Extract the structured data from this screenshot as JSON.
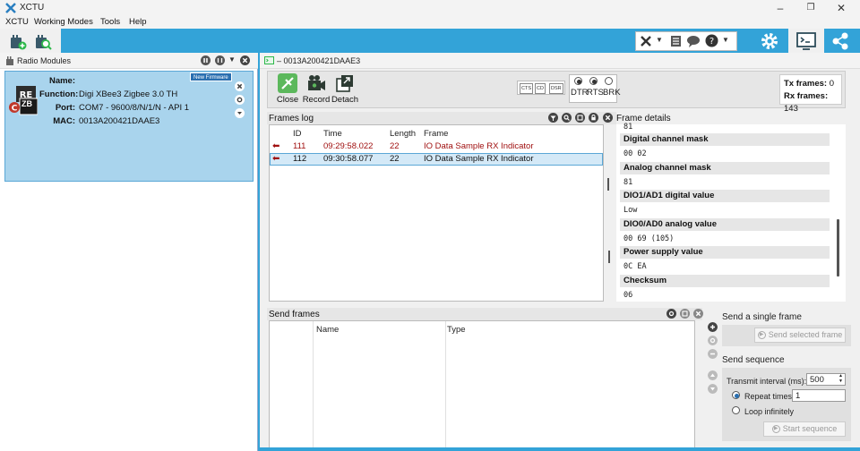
{
  "window": {
    "title": "XCTU",
    "controls": [
      "–",
      "❐",
      "✕"
    ]
  },
  "menu": [
    "XCTU",
    "Working Modes",
    "Tools",
    "Help"
  ],
  "left_panel": {
    "title": "Radio Modules",
    "module": {
      "badge": "New Firmware",
      "logo_text": "ZB",
      "labels": {
        "name": "Name:",
        "function": "Function:",
        "port": "Port:",
        "mac": "MAC:"
      },
      "name": "",
      "function": "Digi XBee3 Zigbee 3.0 TH",
      "port": "COM7 - 9600/8/N/1/N - API 1",
      "mac": "0013A200421DAAE3"
    }
  },
  "console": {
    "tab_title": "– 0013A200421DAAE3",
    "actions": {
      "close": "Close",
      "record": "Record",
      "detach": "Detach"
    },
    "signals": {
      "cts": "CTS",
      "cd": "CD",
      "dsr": "DSR",
      "dtr": "DTR",
      "rts": "RTS",
      "brk": "BRK"
    },
    "counters": {
      "tx_label": "Tx frames:",
      "tx": "0",
      "rx_label": "Rx frames:",
      "rx": "143"
    },
    "frames_log": {
      "title": "Frames log",
      "columns": {
        "id": "ID",
        "time": "Time",
        "length": "Length",
        "frame": "Frame"
      },
      "rows": [
        {
          "id": "111",
          "time": "09:29:58.022",
          "length": "22",
          "frame": "IO Data Sample RX Indicator"
        },
        {
          "id": "112",
          "time": "09:30:58.077",
          "length": "22",
          "frame": "IO Data Sample RX Indicator"
        }
      ]
    },
    "frame_details": {
      "title": "Frame details",
      "top_value": "81",
      "fields": [
        {
          "name": "Digital channel mask",
          "value": "00 02"
        },
        {
          "name": "Analog channel mask",
          "value": "81"
        },
        {
          "name": "DIO1/AD1 digital value",
          "value": "Low"
        },
        {
          "name": "DIO0/AD0 analog value",
          "value": "00 69 (105)"
        },
        {
          "name": "Power supply value",
          "value": "0C EA"
        },
        {
          "name": "Checksum",
          "value": "06"
        }
      ]
    },
    "send_frames": {
      "title": "Send frames",
      "columns": {
        "name": "Name",
        "type": "Type"
      }
    },
    "single_frame": {
      "title": "Send a single frame",
      "button": "Send selected frame"
    },
    "sequence": {
      "title": "Send sequence",
      "interval_label": "Transmit interval (ms):",
      "interval_value": "500",
      "repeat_label": "Repeat times",
      "repeat_value": "1",
      "loop_label": "Loop infinitely",
      "start_button": "Start sequence"
    }
  },
  "colors": {
    "accent": "#33a3d8",
    "selected_row": "#d4e9f7",
    "module_card": "#a9d4ed",
    "frame_red": "#a01010"
  }
}
